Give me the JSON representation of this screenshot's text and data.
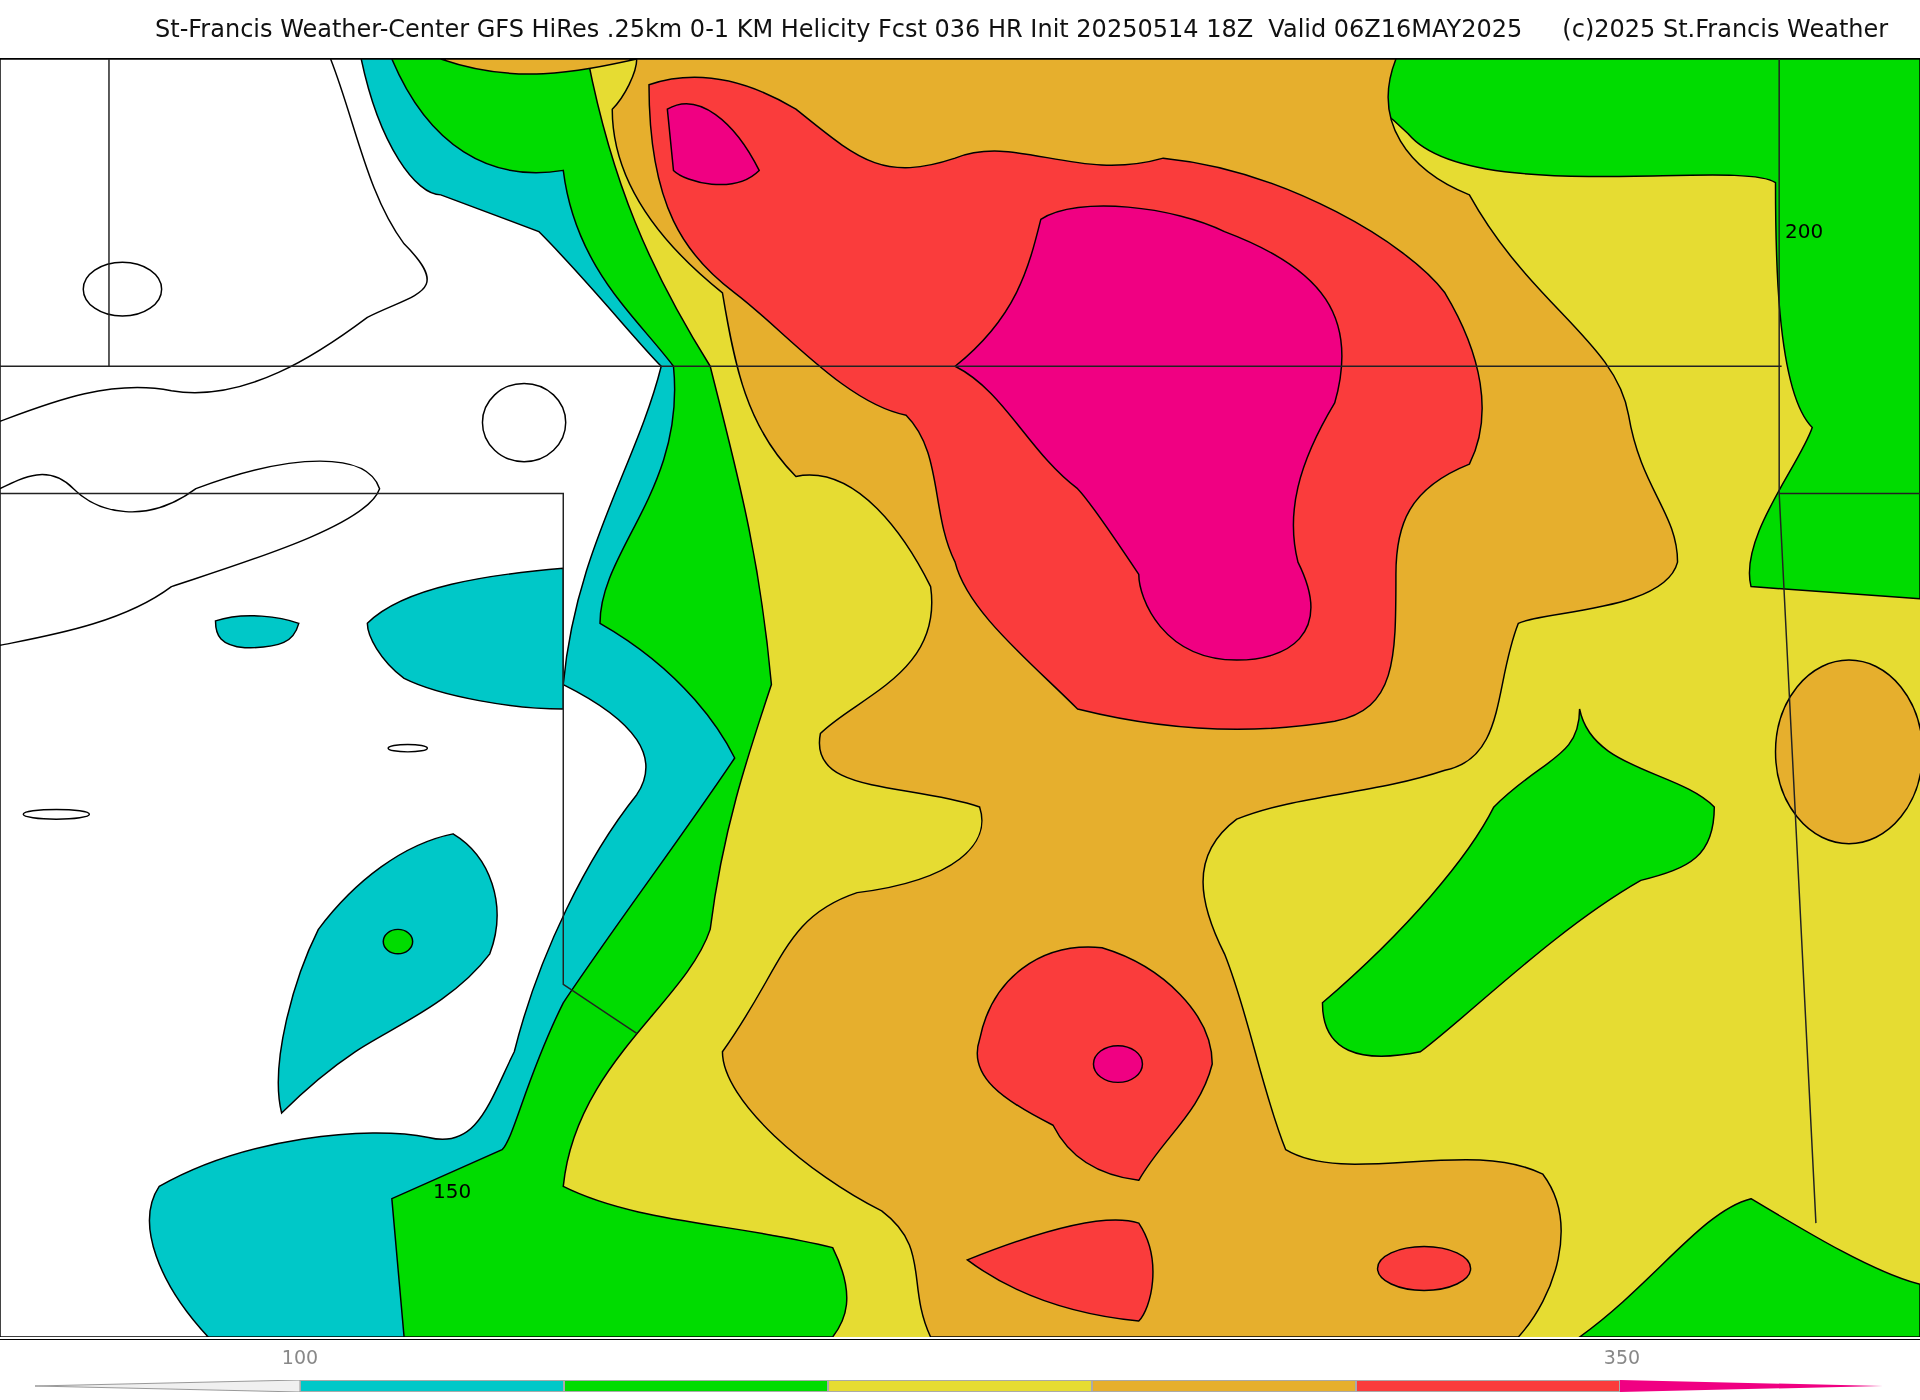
{
  "title": "St-Francis Weather-Center GFS HiRes .25km 0-1 KM Helicity Fcst 036 HR Init 20250514 18Z  Valid 06Z16MAY2025",
  "credit": "(c)2025 St.Francis Weather",
  "map": {
    "contour_labels": [
      "200",
      "150"
    ]
  },
  "colorbar": {
    "ticks": [
      "100",
      "350"
    ],
    "bins": [
      {
        "kind": "under",
        "color": "#f0f0f0"
      },
      {
        "kind": "rect",
        "color": "#00c8c8"
      },
      {
        "kind": "rect",
        "color": "#00dc00"
      },
      {
        "kind": "rect",
        "color": "#e6dc32"
      },
      {
        "kind": "rect",
        "color": "#e6af2d"
      },
      {
        "kind": "rect",
        "color": "#fa3c3c"
      },
      {
        "kind": "over",
        "color": "#f00082"
      }
    ]
  }
}
